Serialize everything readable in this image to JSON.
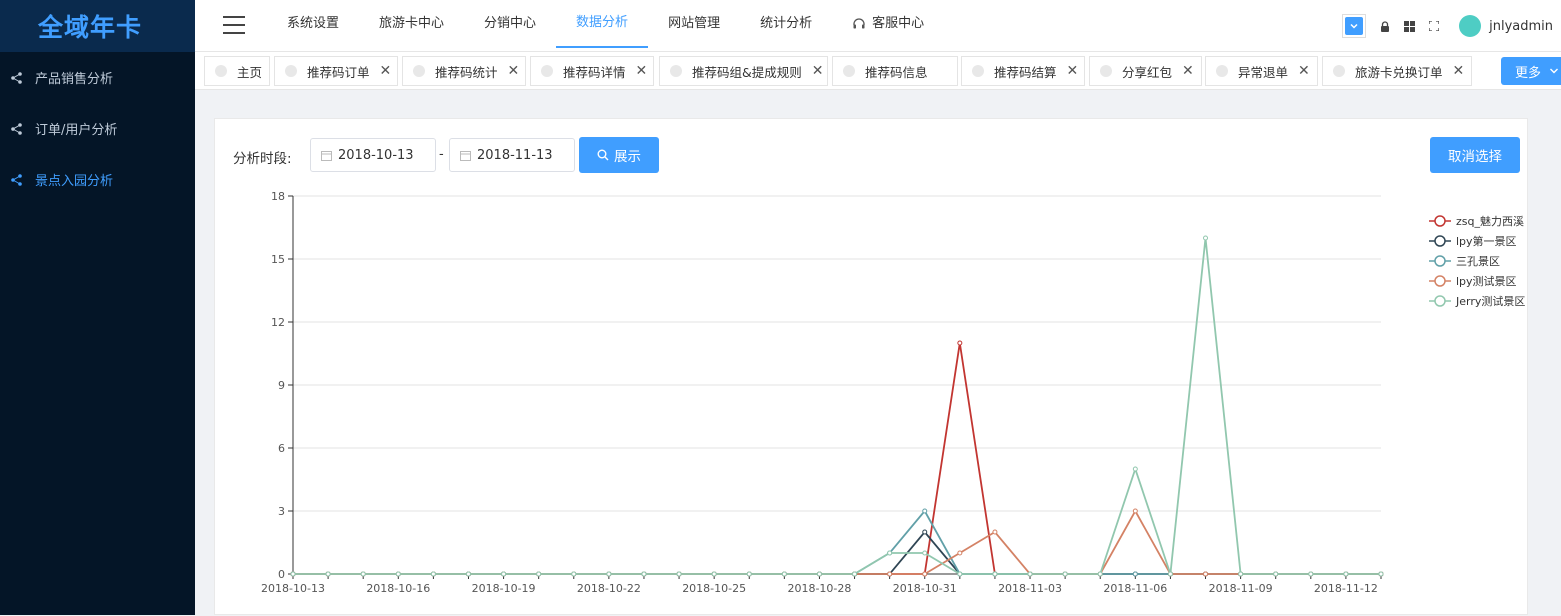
{
  "sidebar": {
    "logo": "全域年卡",
    "items": [
      {
        "label": "产品销售分析",
        "active": false
      },
      {
        "label": "订单/用户分析",
        "active": false
      },
      {
        "label": "景点入园分析",
        "active": true
      }
    ]
  },
  "topnav": {
    "items": [
      "系统设置",
      "旅游卡中心",
      "分销中心",
      "数据分析",
      "网站管理",
      "统计分析",
      "客服中心"
    ],
    "active": "数据分析",
    "user": "jnlyadmin"
  },
  "tabs": {
    "items": [
      "主页",
      "推荐码订单",
      "推荐码统计",
      "推荐码详情",
      "推荐码组&提成规则",
      "推荐码信息",
      "推荐码结算",
      "分享红包",
      "异常退单",
      "旅游卡兑换订单"
    ],
    "more_label": "更多"
  },
  "filter": {
    "label": "分析时段:",
    "start_date": "2018-10-13",
    "end_date": "2018-11-13",
    "separator": "-",
    "show_button": "展示",
    "cancel_button": "取消选择"
  },
  "chart_data": {
    "type": "line",
    "x": [
      "2018-10-13",
      "2018-10-14",
      "2018-10-15",
      "2018-10-16",
      "2018-10-17",
      "2018-10-18",
      "2018-10-19",
      "2018-10-20",
      "2018-10-21",
      "2018-10-22",
      "2018-10-23",
      "2018-10-24",
      "2018-10-25",
      "2018-10-26",
      "2018-10-27",
      "2018-10-28",
      "2018-10-29",
      "2018-10-30",
      "2018-10-31",
      "2018-11-01",
      "2018-11-02",
      "2018-11-03",
      "2018-11-04",
      "2018-11-05",
      "2018-11-06",
      "2018-11-07",
      "2018-11-08",
      "2018-11-09",
      "2018-11-10",
      "2018-11-11",
      "2018-11-12",
      "2018-11-13"
    ],
    "x_tick_labels": [
      "2018-10-13",
      "2018-10-16",
      "2018-10-19",
      "2018-10-22",
      "2018-10-25",
      "2018-10-28",
      "2018-10-31",
      "2018-11-03",
      "2018-11-06",
      "2018-11-09",
      "2018-11-12"
    ],
    "y_ticks": [
      0,
      3,
      6,
      9,
      12,
      15,
      18
    ],
    "ylim": [
      0,
      18
    ],
    "grid": true,
    "legend_position": "right",
    "series": [
      {
        "name": "zsq_魅力西溪",
        "color": "#c23531",
        "values": [
          0,
          0,
          0,
          0,
          0,
          0,
          0,
          0,
          0,
          0,
          0,
          0,
          0,
          0,
          0,
          0,
          0,
          0,
          0,
          11,
          0,
          0,
          0,
          0,
          0,
          0,
          0,
          0,
          0,
          0,
          0,
          0
        ]
      },
      {
        "name": "lpy第一景区",
        "color": "#2f4554",
        "values": [
          0,
          0,
          0,
          0,
          0,
          0,
          0,
          0,
          0,
          0,
          0,
          0,
          0,
          0,
          0,
          0,
          0,
          0,
          2,
          0,
          0,
          0,
          0,
          0,
          0,
          0,
          0,
          0,
          0,
          0,
          0,
          0
        ]
      },
      {
        "name": "三孔景区",
        "color": "#61a0a8",
        "values": [
          0,
          0,
          0,
          0,
          0,
          0,
          0,
          0,
          0,
          0,
          0,
          0,
          0,
          0,
          0,
          0,
          0,
          1,
          3,
          0,
          0,
          0,
          0,
          0,
          0,
          0,
          0,
          0,
          0,
          0,
          0,
          0
        ]
      },
      {
        "name": "lpy测试景区",
        "color": "#d48265",
        "values": [
          0,
          0,
          0,
          0,
          0,
          0,
          0,
          0,
          0,
          0,
          0,
          0,
          0,
          0,
          0,
          0,
          0,
          0,
          0,
          1,
          2,
          0,
          0,
          0,
          3,
          0,
          0,
          0,
          0,
          0,
          0,
          0
        ]
      },
      {
        "name": "Jerry测试景区",
        "color": "#91c7ae",
        "values": [
          0,
          0,
          0,
          0,
          0,
          0,
          0,
          0,
          0,
          0,
          0,
          0,
          0,
          0,
          0,
          0,
          0,
          1,
          1,
          0,
          0,
          0,
          0,
          0,
          5,
          0,
          16,
          0,
          0,
          0,
          0,
          0
        ]
      }
    ]
  }
}
